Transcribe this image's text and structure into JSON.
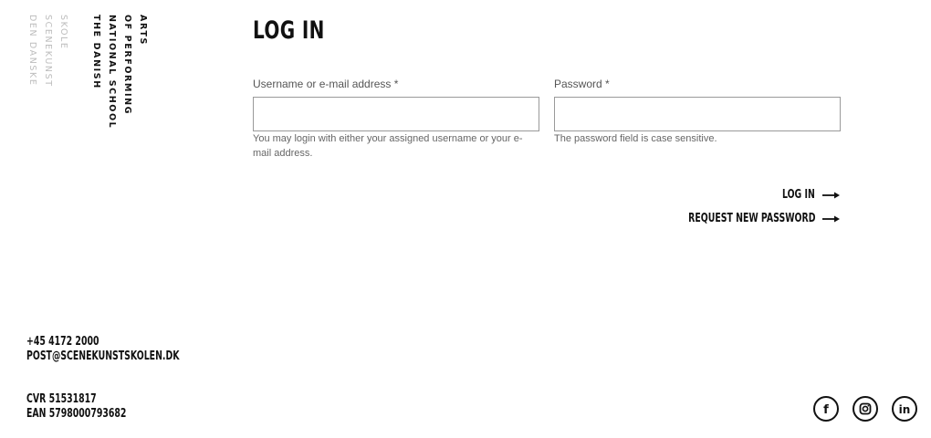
{
  "logo": {
    "danish_lines": [
      "DEN DANSKE",
      "SCENEKUNST",
      "SKOLE"
    ],
    "english_lines": [
      "THE DANISH",
      "NATIONAL SCHOOL",
      "OF PERFORMING",
      "ARTS"
    ]
  },
  "login": {
    "title": "LOG IN",
    "username_label": "Username or e-mail address *",
    "username_value": "",
    "username_hint": "You may login with either your assigned username or your e-mail address.",
    "password_label": "Password *",
    "password_value": "",
    "password_hint": "The password field is case sensitive.",
    "login_action": "LOG IN",
    "request_password_action": "REQUEST NEW PASSWORD"
  },
  "footer": {
    "phone": "+45 4172 2000",
    "email": "POST@SCENEKUNSTSKOLEN.DK",
    "cvr": "CVR 51531817",
    "ean": "EAN 5798000793682",
    "social_icons": [
      "facebook-icon",
      "instagram-icon",
      "linkedin-icon"
    ]
  },
  "colors": {
    "text": "#111111",
    "muted": "#666666",
    "logo_grey": "#bdbdbd",
    "input_border": "#9a9a9a"
  }
}
